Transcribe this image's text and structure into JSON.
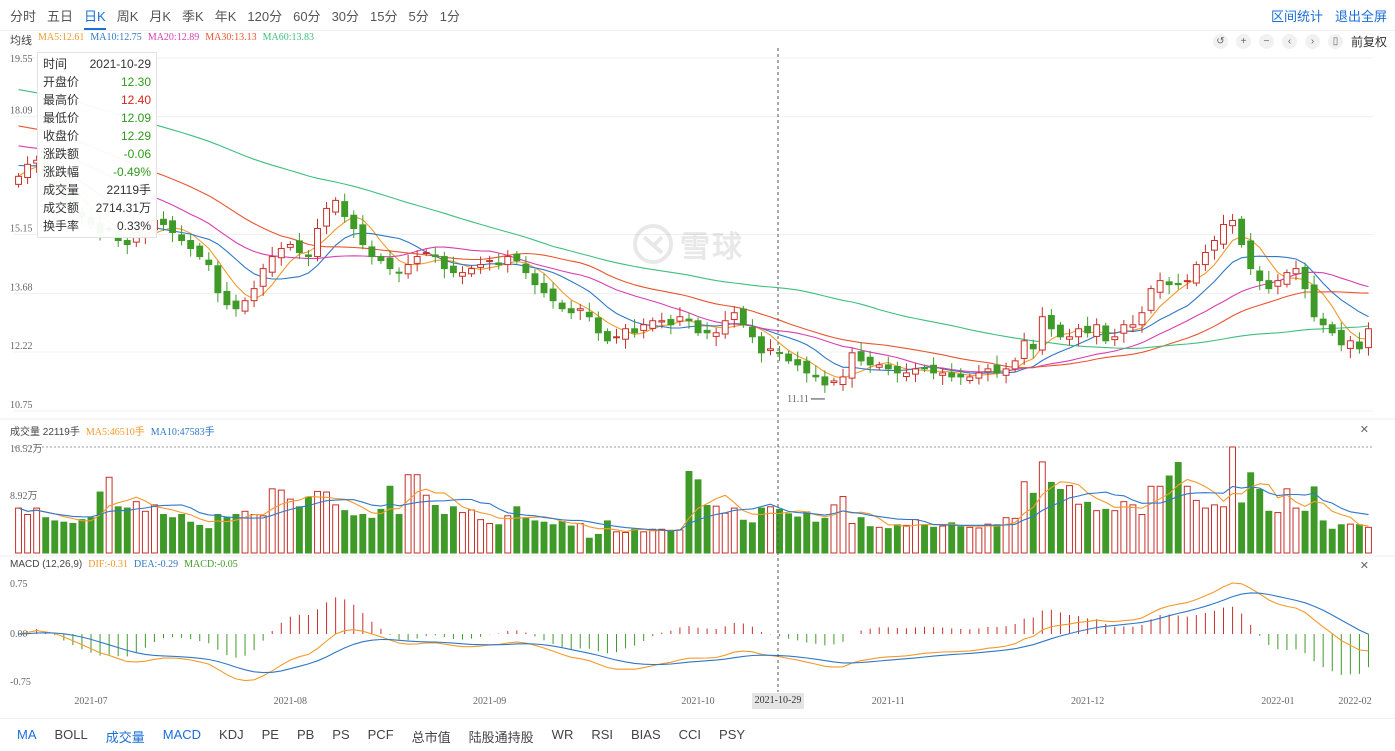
{
  "period_tabs": [
    "分时",
    "五日",
    "日K",
    "周K",
    "月K",
    "季K",
    "年K",
    "120分",
    "60分",
    "30分",
    "15分",
    "5分",
    "1分"
  ],
  "active_period": "日K",
  "top_actions": {
    "range_stats": "区间统计",
    "exit_fullscreen": "退出全屏"
  },
  "ma_legend": {
    "label": "均线",
    "ma5": "MA5:12.61",
    "ma10": "MA10:12.75",
    "ma20": "MA20:12.89",
    "ma30": "MA30:13.13",
    "ma60": "MA60:13.83"
  },
  "tools": {
    "adjust": "前复权"
  },
  "tooltip": [
    {
      "label": "时间",
      "value": "2021-10-29",
      "tone": ""
    },
    {
      "label": "开盘价",
      "value": "12.30",
      "tone": "green"
    },
    {
      "label": "最高价",
      "value": "12.40",
      "tone": "red"
    },
    {
      "label": "最低价",
      "value": "12.09",
      "tone": "green"
    },
    {
      "label": "收盘价",
      "value": "12.29",
      "tone": "green"
    },
    {
      "label": "涨跌额",
      "value": "-0.06",
      "tone": "green"
    },
    {
      "label": "涨跌幅",
      "value": "-0.49%",
      "tone": "green"
    },
    {
      "label": "成交量",
      "value": "22119手",
      "tone": ""
    },
    {
      "label": "成交额",
      "value": "2714.31万",
      "tone": ""
    },
    {
      "label": "换手率",
      "value": "0.33%",
      "tone": ""
    }
  ],
  "volume_legend": {
    "label": "成交量 22119手",
    "ma5": "MA5:46510手",
    "ma10": "MA10:47583手"
  },
  "macd_legend": {
    "label": "MACD (12,26,9)",
    "dif": "DIF:-0.31",
    "dea": "DEA:-0.29",
    "macd": "MACD:-0.05"
  },
  "watermark": "雪球",
  "crosshair_date": "2021-10-29",
  "indicator_tabs": [
    "MA",
    "BOLL",
    "成交量",
    "MACD",
    "KDJ",
    "PE",
    "PB",
    "PS",
    "PCF",
    "总市值",
    "陆股通持股",
    "WR",
    "RSI",
    "BIAS",
    "CCI",
    "PSY"
  ],
  "active_indicators": [
    "MA",
    "成交量",
    "MACD"
  ],
  "colors": {
    "up": "#c6302a",
    "down": "#3f9a28",
    "ma5": "#f39a2b",
    "ma10": "#2f78c8",
    "ma20": "#d93fb0",
    "ma30": "#e9552e",
    "ma60": "#3fbf7f",
    "dif": "#f39a2b",
    "dea": "#2f78c8"
  },
  "chart_data": {
    "type": "candlestick",
    "price_axis": {
      "ticks": [
        "19.55",
        "18.09",
        "15.15",
        "13.68",
        "12.22",
        "10.75"
      ],
      "ylim": [
        10.75,
        19.55
      ]
    },
    "x_ticks": [
      "2021-07",
      "2021-08",
      "2021-09",
      "2021-10",
      "2021-11",
      "2021-12",
      "2022-01",
      "2022-02"
    ],
    "annotation": "11.11",
    "closes": [
      16.6,
      16.9,
      17.0,
      16.5,
      16.4,
      16.0,
      15.8,
      15.6,
      15.4,
      15.2,
      15.3,
      15.0,
      14.9,
      15.2,
      15.3,
      15.5,
      15.4,
      15.2,
      15.0,
      14.8,
      14.6,
      14.4,
      13.7,
      13.4,
      13.3,
      13.5,
      13.8,
      14.3,
      14.6,
      14.8,
      14.9,
      14.7,
      14.6,
      15.3,
      15.8,
      16.0,
      15.6,
      15.3,
      14.9,
      14.6,
      14.5,
      14.3,
      14.2,
      14.4,
      14.6,
      14.7,
      14.6,
      14.3,
      14.2,
      14.2,
      14.3,
      14.4,
      14.5,
      14.4,
      14.6,
      14.5,
      14.2,
      13.9,
      13.7,
      13.5,
      13.3,
      13.2,
      13.3,
      13.1,
      12.7,
      12.5,
      12.6,
      12.8,
      12.7,
      12.9,
      13.0,
      13.0,
      12.9,
      13.1,
      13.0,
      12.7,
      12.7,
      12.7,
      13.0,
      13.2,
      12.9,
      12.6,
      12.2,
      12.3,
      12.2,
      12.0,
      11.9,
      11.7,
      11.6,
      11.4,
      11.5,
      11.6,
      12.2,
      12.0,
      11.9,
      11.9,
      11.8,
      11.7,
      11.7,
      11.8,
      11.8,
      11.7,
      11.7,
      11.6,
      11.6,
      11.6,
      11.7,
      11.8,
      11.7,
      11.8,
      12.0,
      12.5,
      12.3,
      13.1,
      12.8,
      12.6,
      12.6,
      12.8,
      12.7,
      12.9,
      12.5,
      12.6,
      12.9,
      12.9,
      13.2,
      13.8,
      14.0,
      13.9,
      13.9,
      14.0,
      14.4,
      14.7,
      15.0,
      15.4,
      15.5,
      14.9,
      14.3,
      14.0,
      13.8,
      14.0,
      14.2,
      14.3,
      13.8,
      13.1,
      12.9,
      12.7,
      12.4,
      12.5,
      12.3,
      12.8
    ],
    "volumes": [
      7.0,
      6.0,
      7.0,
      5.5,
      5.0,
      4.8,
      4.6,
      5.2,
      5.5,
      9.5,
      11.8,
      7.2,
      7.0,
      8.0,
      6.5,
      7.5,
      6.0,
      5.5,
      6.0,
      4.8,
      4.3,
      3.8,
      6.0,
      5.5,
      6.0,
      6.5,
      6.0,
      5.8,
      10.0,
      9.8,
      8.4,
      7.2,
      8.7,
      9.6,
      9.5,
      7.5,
      6.6,
      5.8,
      6.0,
      5.4,
      6.8,
      10.4,
      6.0,
      12.2,
      12.2,
      9.0,
      7.4,
      6.0,
      7.2,
      6.3,
      6.7,
      5.2,
      4.6,
      4.4,
      5.8,
      7.2,
      5.5,
      5.0,
      4.8,
      4.4,
      4.9,
      4.2,
      4.6,
      2.3,
      2.9,
      5.0,
      3.3,
      3.2,
      3.7,
      3.3,
      3.7,
      3.7,
      3.4,
      3.6,
      12.7,
      11.4,
      7.4,
      7.3,
      6.2,
      7.0,
      5.1,
      4.7,
      7.0,
      7.2,
      6.8,
      6.1,
      5.6,
      6.4,
      4.8,
      5.4,
      7.5,
      8.8,
      4.6,
      5.5,
      4.1,
      4.0,
      3.8,
      4.4,
      4.3,
      5.2,
      4.4,
      4.0,
      4.2,
      4.7,
      4.1,
      4.0,
      3.9,
      4.5,
      4.4,
      5.5,
      5.4,
      11.1,
      9.3,
      14.2,
      11.0,
      9.9,
      10.5,
      7.6,
      7.9,
      6.6,
      6.8,
      6.6,
      8.0,
      7.5,
      6.0,
      10.4,
      10.4,
      12.0,
      14.1,
      10.4,
      8.2,
      7.0,
      7.5,
      7.2,
      16.52,
      7.8,
      12.5,
      9.9,
      6.5,
      6.3,
      10.0,
      7.0,
      6.5,
      10.3,
      5.0,
      3.7,
      4.4,
      4.5,
      4.4,
      4.0
    ]
  }
}
